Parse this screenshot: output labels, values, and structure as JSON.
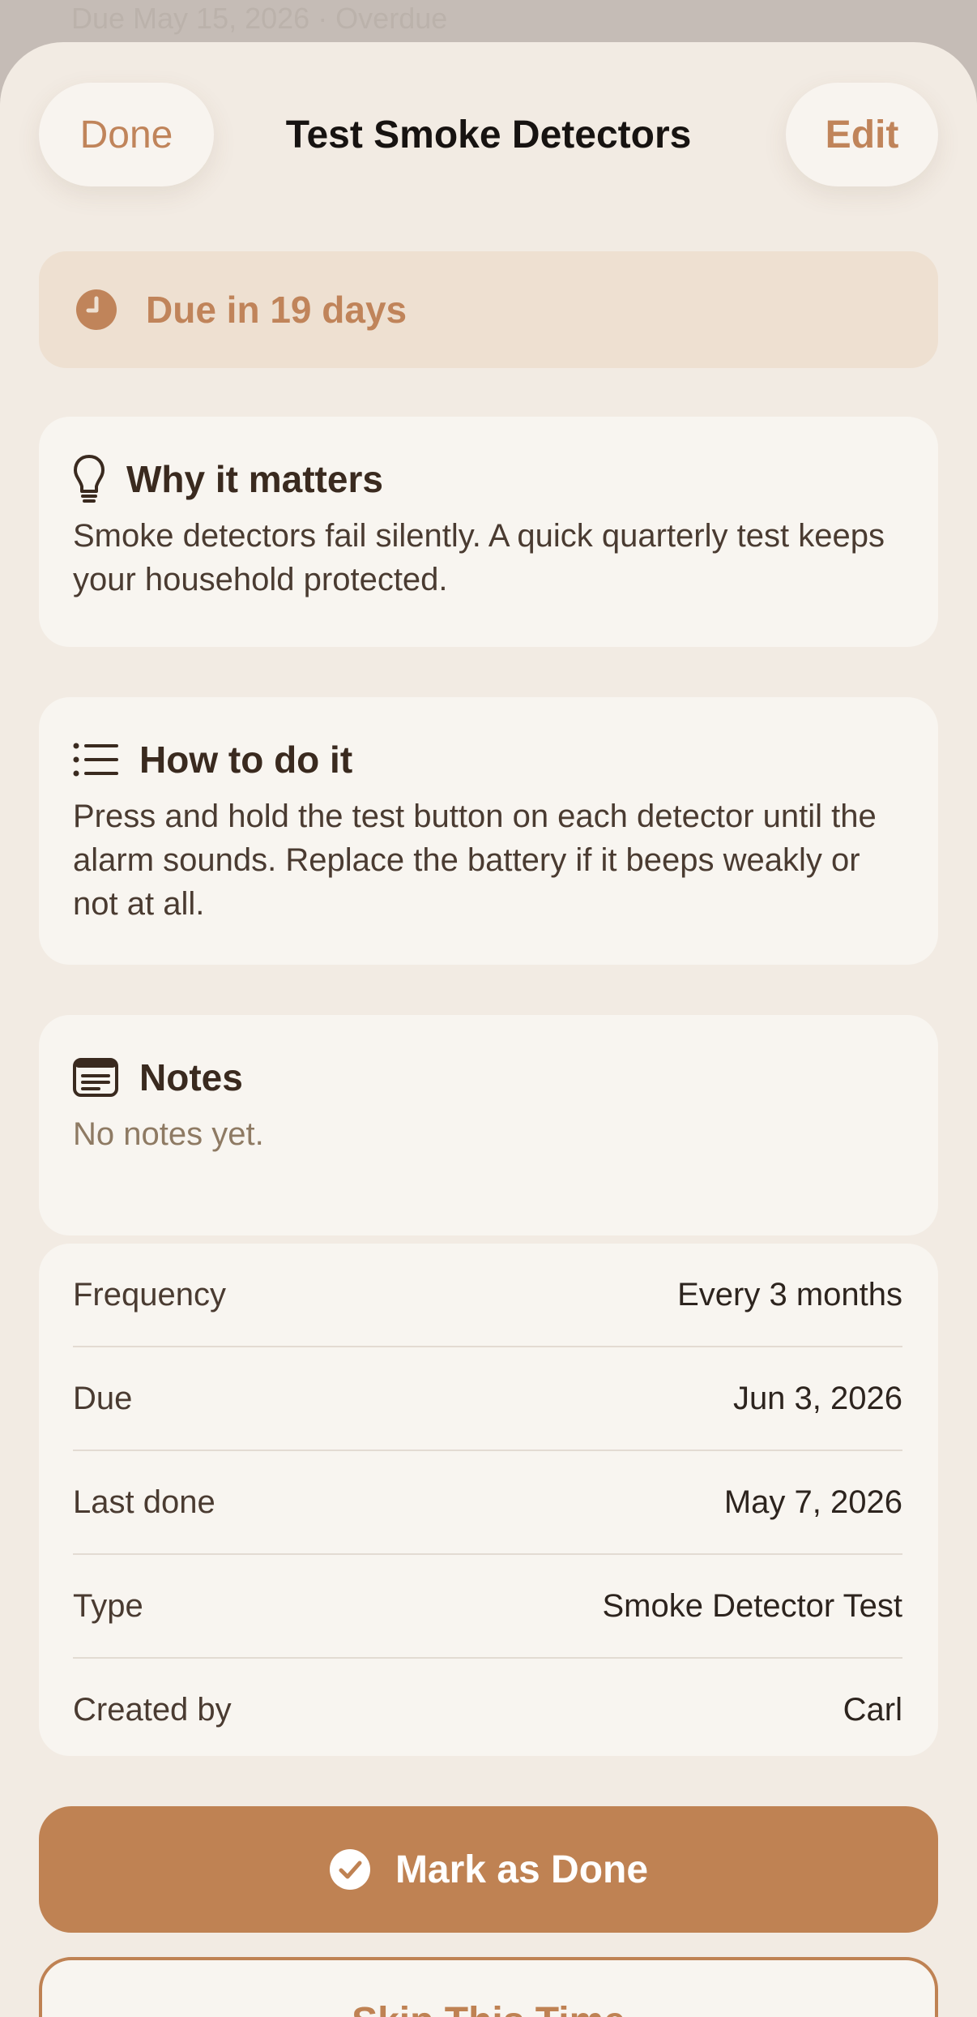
{
  "background": {
    "partial_text": "Due May 15, 2026 · Overdue"
  },
  "header": {
    "done_label": "Done",
    "title": "Test Smoke Detectors",
    "edit_label": "Edit"
  },
  "due_banner": {
    "icon": "clock-icon",
    "text": "Due in 19 days"
  },
  "why": {
    "icon": "lightbulb-icon",
    "heading": "Why it matters",
    "body": "Smoke detectors fail silently. A quick quarterly test keeps your household protected."
  },
  "how": {
    "icon": "list-icon",
    "heading": "How to do it",
    "body": "Press and hold the test button on each detector until the alarm sounds. Replace the battery if it beeps weakly or not at all."
  },
  "notes": {
    "icon": "note-icon",
    "heading": "Notes",
    "body": "No notes yet."
  },
  "details": [
    {
      "label": "Frequency",
      "value": "Every 3 months"
    },
    {
      "label": "Due",
      "value": "Jun 3, 2026"
    },
    {
      "label": "Last done",
      "value": "May 7, 2026"
    },
    {
      "label": "Type",
      "value": "Smoke Detector Test"
    },
    {
      "label": "Created by",
      "value": "Carl"
    }
  ],
  "actions": {
    "mark_done_icon": "checkmark-circle-icon",
    "mark_done_label": "Mark as Done",
    "skip_label": "Skip This Time"
  },
  "colors": {
    "accent": "#bf8253",
    "sheet": "#f2ebe3",
    "card": "#f8f5f0"
  }
}
